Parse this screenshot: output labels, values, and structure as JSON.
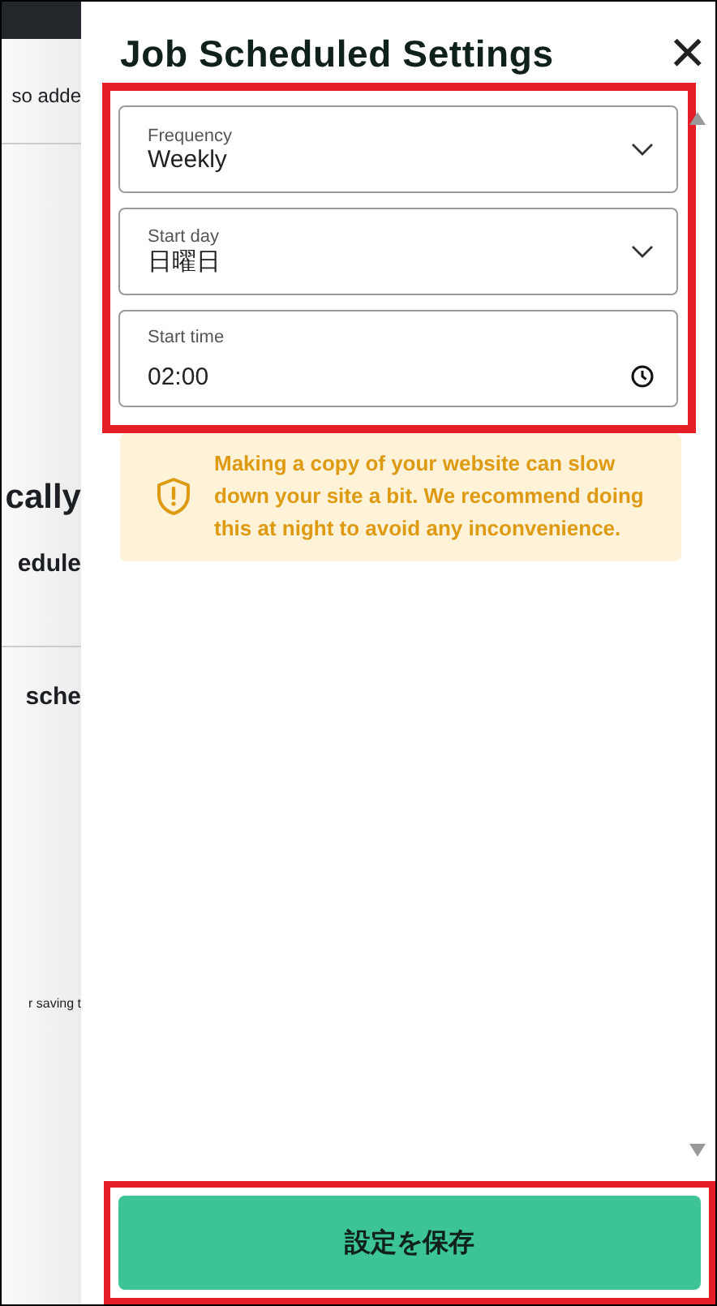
{
  "background_page": {
    "texts": [
      {
        "kind": "body",
        "text": "so adde"
      },
      {
        "kind": "heading",
        "text": "cally"
      },
      {
        "kind": "subheading",
        "text": "edule"
      },
      {
        "kind": "subheading",
        "text": "sche"
      },
      {
        "kind": "small",
        "text": "r saving t"
      }
    ]
  },
  "panel": {
    "title": "Job Scheduled Settings",
    "close": "×",
    "fields": [
      {
        "kind": "select",
        "label": "Frequency",
        "value": "Weekly"
      },
      {
        "kind": "select",
        "label": "Start day",
        "value": "日曜日"
      },
      {
        "kind": "time",
        "label": "Start time",
        "value": "02:00"
      }
    ],
    "fields_highlighted": true,
    "warning": "Making a copy of your website can slow down your site a bit. We recommend doing this at night to avoid any inconvenience.",
    "save_button": {
      "label": "設定を保存",
      "highlighted": true
    }
  }
}
